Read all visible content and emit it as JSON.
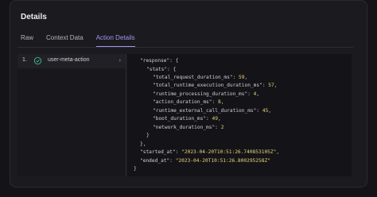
{
  "header": {
    "title": "Details"
  },
  "tabs": [
    {
      "label": "Raw",
      "active": false
    },
    {
      "label": "Context Data",
      "active": false
    },
    {
      "label": "Action Details",
      "active": true
    }
  ],
  "actions": [
    {
      "index": "1.",
      "icon": "check-circle-icon",
      "label": "user-meta-action"
    }
  ],
  "code": {
    "l1": "\"response\": {",
    "l2": "\"stats\": {",
    "total_request_key": "\"total_request_duration_ms\": ",
    "total_request_val": "59",
    "total_runtime_key": "\"total_runtime_execution_duration_ms\": ",
    "total_runtime_val": "57",
    "runtime_processing_key": "\"runtime_processing_duration_ms\": ",
    "runtime_processing_val": "4",
    "action_key": "\"action_duration_ms\": ",
    "action_val": "8",
    "external_key": "\"runtime_external_call_duration_ms\": ",
    "external_val": "45",
    "boot_key": "\"boot_duration_ms\": ",
    "boot_val": "49",
    "network_key": "\"network_duration_ms\": ",
    "network_val": "2",
    "close_inner": "}",
    "close_outer": "},",
    "started_key": "\"started_at\": ",
    "started_val": "\"2023-04-20T10:51:26.740853105Z\"",
    "ended_key": "\"ended_at\": ",
    "ended_val": "\"2023-04-20T10:51:26.800295258Z\"",
    "close_root": "}"
  },
  "colors": {
    "accent": "#a794f0",
    "success": "#3fb98a",
    "value": "#e7d27a"
  }
}
